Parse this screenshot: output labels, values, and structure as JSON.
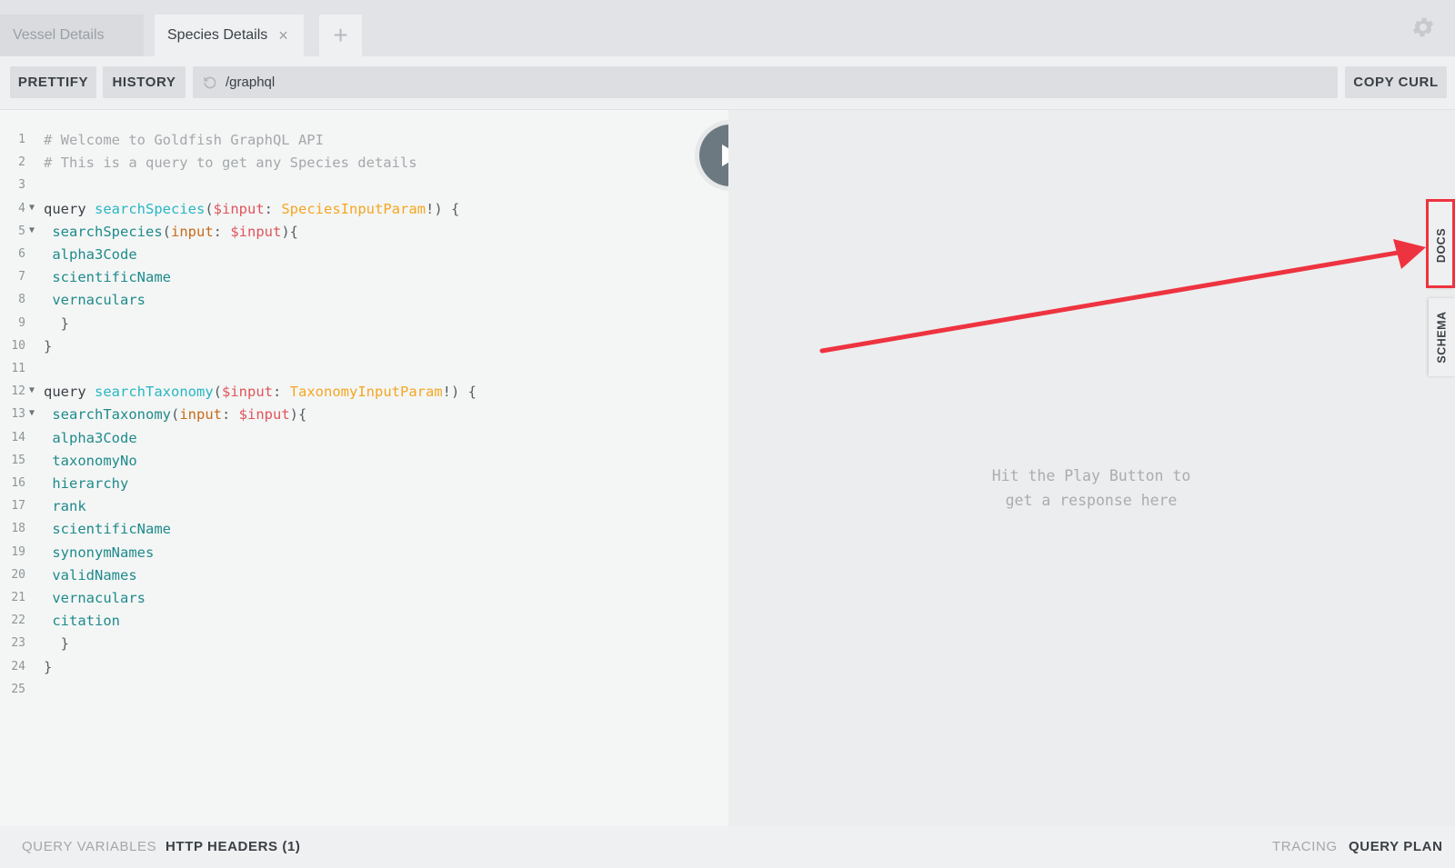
{
  "tabs": [
    {
      "label": "Vessel Details"
    },
    {
      "label": "Species Details",
      "close": "×"
    }
  ],
  "add_tab_label": "+",
  "toolbar": {
    "prettify": "PRETTIFY",
    "history": "HISTORY",
    "url": "/graphql",
    "copy_curl": "COPY CURL"
  },
  "editor": {
    "lines": [
      {
        "n": "1",
        "segs": [
          [
            "c-comment",
            "# Welcome to Goldfish GraphQL API"
          ]
        ]
      },
      {
        "n": "2",
        "segs": [
          [
            "c-comment",
            "# This is a query to get any Species details"
          ]
        ]
      },
      {
        "n": "3",
        "segs": []
      },
      {
        "n": "4",
        "fold": true,
        "segs": [
          [
            "c-kw",
            "query "
          ],
          [
            "c-fn",
            "searchSpecies"
          ],
          [
            "c-punc",
            "("
          ],
          [
            "c-var",
            "$input"
          ],
          [
            "c-punc",
            ": "
          ],
          [
            "c-type",
            "SpeciesInputParam"
          ],
          [
            "c-punc",
            "!) {"
          ]
        ]
      },
      {
        "n": "5",
        "fold": true,
        "segs": [
          [
            "c-field",
            " searchSpecies"
          ],
          [
            "c-punc",
            "("
          ],
          [
            "c-arg",
            "input"
          ],
          [
            "c-punc",
            ": "
          ],
          [
            "c-var",
            "$input"
          ],
          [
            "c-punc",
            "){"
          ]
        ]
      },
      {
        "n": "6",
        "segs": [
          [
            "c-field",
            " alpha3Code"
          ]
        ]
      },
      {
        "n": "7",
        "segs": [
          [
            "c-field",
            " scientificName"
          ]
        ]
      },
      {
        "n": "8",
        "segs": [
          [
            "c-field",
            " vernaculars"
          ]
        ]
      },
      {
        "n": "9",
        "segs": [
          [
            "c-punc",
            "  }"
          ]
        ]
      },
      {
        "n": "10",
        "segs": [
          [
            "c-punc",
            "}"
          ]
        ]
      },
      {
        "n": "11",
        "segs": []
      },
      {
        "n": "12",
        "fold": true,
        "segs": [
          [
            "c-kw",
            "query "
          ],
          [
            "c-fn",
            "searchTaxonomy"
          ],
          [
            "c-punc",
            "("
          ],
          [
            "c-var",
            "$input"
          ],
          [
            "c-punc",
            ": "
          ],
          [
            "c-type",
            "TaxonomyInputParam"
          ],
          [
            "c-punc",
            "!) {"
          ]
        ]
      },
      {
        "n": "13",
        "fold": true,
        "segs": [
          [
            "c-field",
            " searchTaxonomy"
          ],
          [
            "c-punc",
            "("
          ],
          [
            "c-arg",
            "input"
          ],
          [
            "c-punc",
            ": "
          ],
          [
            "c-var",
            "$input"
          ],
          [
            "c-punc",
            "){"
          ]
        ]
      },
      {
        "n": "14",
        "segs": [
          [
            "c-field",
            " alpha3Code"
          ]
        ]
      },
      {
        "n": "15",
        "segs": [
          [
            "c-field",
            " taxonomyNo"
          ]
        ]
      },
      {
        "n": "16",
        "segs": [
          [
            "c-field",
            " hierarchy"
          ]
        ]
      },
      {
        "n": "17",
        "segs": [
          [
            "c-field",
            " rank"
          ]
        ]
      },
      {
        "n": "18",
        "segs": [
          [
            "c-field",
            " scientificName"
          ]
        ]
      },
      {
        "n": "19",
        "segs": [
          [
            "c-field",
            " synonymNames"
          ]
        ]
      },
      {
        "n": "20",
        "segs": [
          [
            "c-field",
            " validNames"
          ]
        ]
      },
      {
        "n": "21",
        "segs": [
          [
            "c-field",
            " vernaculars"
          ]
        ]
      },
      {
        "n": "22",
        "segs": [
          [
            "c-field",
            " citation"
          ]
        ]
      },
      {
        "n": "23",
        "segs": [
          [
            "c-punc",
            "  }"
          ]
        ]
      },
      {
        "n": "24",
        "segs": [
          [
            "c-punc",
            "}"
          ]
        ]
      },
      {
        "n": "25",
        "segs": []
      }
    ]
  },
  "result": {
    "hint_line1": "Hit the Play Button to",
    "hint_line2": "get a response here"
  },
  "side_tabs": {
    "docs": "DOCS",
    "schema": "SCHEMA"
  },
  "bottom": {
    "query_variables": "QUERY VARIABLES",
    "http_headers": "HTTP HEADERS (1)",
    "tracing": "TRACING",
    "query_plan": "QUERY PLAN"
  },
  "icons": {
    "gear": "gear-icon",
    "reload": "reload-icon",
    "play": "play-icon",
    "close": "close-icon"
  },
  "colors": {
    "annotation": "#ee3340",
    "play_button": "#6d7980",
    "type": "#f5a623",
    "variable": "#e0555c",
    "function": "#2ab6c4",
    "field": "#1f8a8c"
  }
}
